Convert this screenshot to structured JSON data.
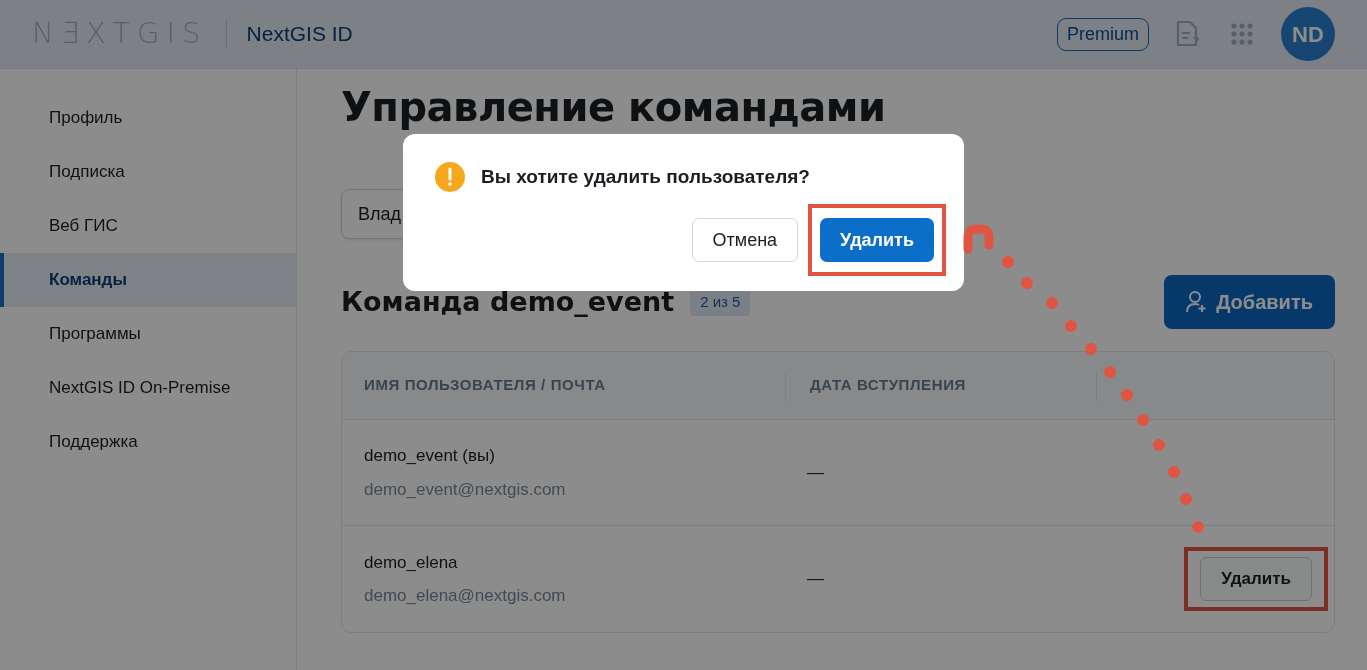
{
  "header": {
    "logo": "N∃XTGIS",
    "app_name": "NextGIS ID",
    "plan_badge": "Premium",
    "avatar": "ND"
  },
  "sidebar": {
    "items": [
      {
        "label": "Профиль",
        "selected": false
      },
      {
        "label": "Подписка",
        "selected": false
      },
      {
        "label": "Веб ГИС",
        "selected": false
      },
      {
        "label": "Команды",
        "selected": true
      },
      {
        "label": "Программы",
        "selected": false
      },
      {
        "label": "NextGIS ID On-Premise",
        "selected": false
      },
      {
        "label": "Поддержка",
        "selected": false
      }
    ]
  },
  "page_title": "Управление командами",
  "owner_select": {
    "value": "Влад"
  },
  "team": {
    "title": "Команда demo_event",
    "count": "2 из 5",
    "add_button": "Добавить"
  },
  "table": {
    "columns": [
      "ИМЯ ПОЛЬЗОВАТЕЛЯ / ПОЧТА",
      "ДАТА ВСТУПЛЕНИЯ"
    ],
    "rows": [
      {
        "name": "demo_event (вы)",
        "email": "demo_event@nextgis.com",
        "joined": "—"
      },
      {
        "name": "demo_elena",
        "email": "demo_elena@nextgis.com",
        "joined": "—",
        "action": {
          "label": "Удалить",
          "highlighted": true
        }
      }
    ]
  },
  "dialog": {
    "message": "Вы хотите удалить пользователя?",
    "buttons": [
      {
        "label": "Отмена",
        "kind": "secondary",
        "highlighted": false
      },
      {
        "label": "Удалить",
        "kind": "primary",
        "highlighted": true
      }
    ]
  }
}
